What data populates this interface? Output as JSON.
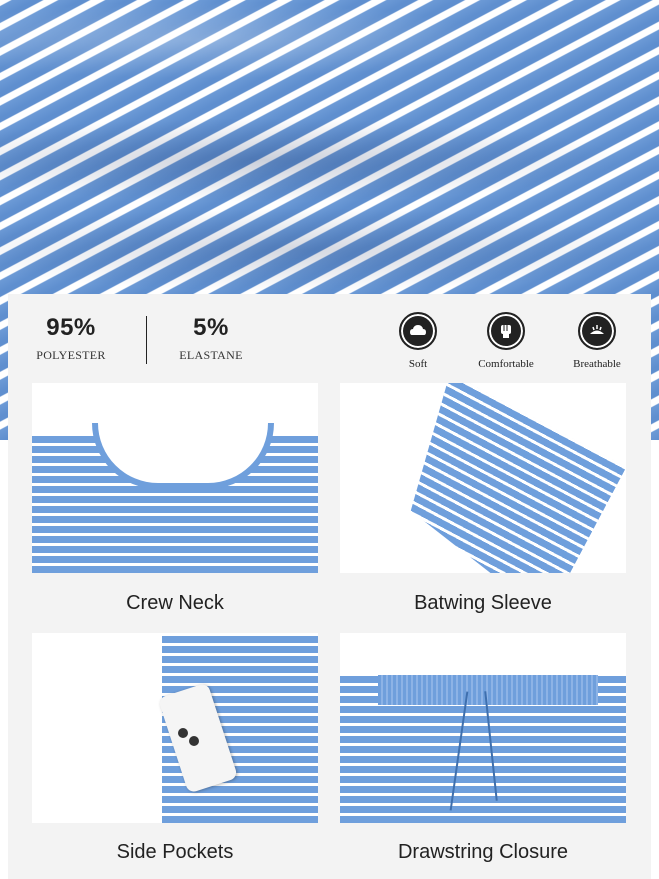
{
  "stats": [
    {
      "value": "95%",
      "label": "POLYESTER"
    },
    {
      "value": "5%",
      "label": "ELASTANE"
    }
  ],
  "features": [
    {
      "icon": "cloud-soft-icon",
      "label": "Soft"
    },
    {
      "icon": "fist-comfortable-icon",
      "label": "Comfortable"
    },
    {
      "icon": "wind-breathable-icon",
      "label": "Breathable"
    }
  ],
  "tiles": [
    {
      "caption": "Crew Neck"
    },
    {
      "caption": "Batwing Sleeve"
    },
    {
      "caption": "Side Pockets"
    },
    {
      "caption": "Drawstring Closure"
    }
  ],
  "colors": {
    "stripe_blue": "#6f9fdc",
    "panel_bg": "#f3f3f3",
    "text": "#222222"
  }
}
